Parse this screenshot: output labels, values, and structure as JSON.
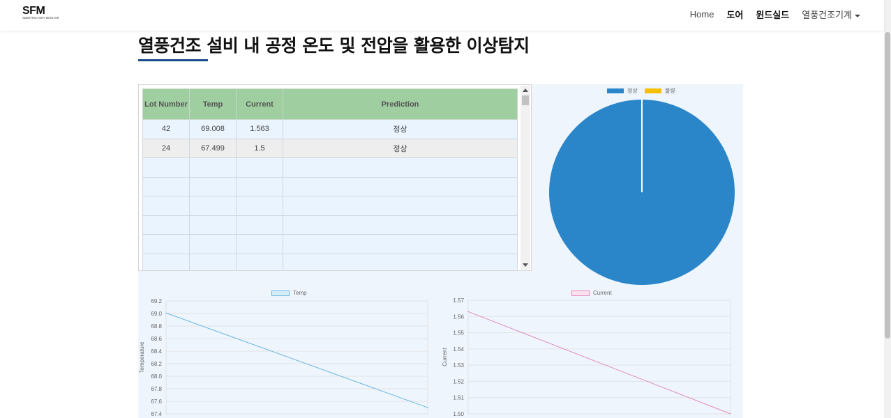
{
  "logo": {
    "main": "SFM",
    "sub": "SMARTFACTORY MONITOR"
  },
  "nav": {
    "home": "Home",
    "door": "도어",
    "windshield": "윈드실드",
    "dryer": "열풍건조기계"
  },
  "page": {
    "title": "열풍건조 설비 내 공정 온도 및 전압을 활용한 이상탐지"
  },
  "table": {
    "headers": {
      "lot": "Lot Number",
      "temp": "Temp",
      "current": "Current",
      "prediction": "Prediction"
    },
    "rows": [
      {
        "lot": "42",
        "temp": "69.008",
        "current": "1.563",
        "prediction": "정상"
      },
      {
        "lot": "24",
        "temp": "67.499",
        "current": "1.5",
        "prediction": "정상"
      }
    ],
    "empty_rows": 6
  },
  "colors": {
    "normal": "#2a86c8",
    "defect": "#f5c000",
    "temp_line": "#6cb8e0",
    "current_line": "#e48ac0",
    "header_green": "#9fcfa0",
    "panel_bg": "#eef5fd",
    "title_underline": "#1a4b8f"
  },
  "chart_data": [
    {
      "type": "pie",
      "legend": [
        "정상",
        "불량"
      ],
      "values": [
        2,
        0
      ],
      "legend_position": "top"
    },
    {
      "type": "line",
      "legend": [
        "Temp"
      ],
      "ylabel": "Temperature",
      "ylim": [
        67.4,
        69.2
      ],
      "yticks": [
        "69.2",
        "69.0",
        "68.8",
        "68.6",
        "68.4",
        "68.2",
        "68.0",
        "67.8",
        "67.6",
        "67.4"
      ],
      "series": [
        {
          "name": "Temp",
          "values": [
            69.008,
            67.499
          ]
        }
      ],
      "grid": true
    },
    {
      "type": "line",
      "legend": [
        "Current"
      ],
      "ylabel": "Current",
      "ylim": [
        1.5,
        1.57
      ],
      "yticks": [
        "1.57",
        "1.56",
        "1.55",
        "1.54",
        "1.53",
        "1.52",
        "1.51",
        "1.50"
      ],
      "series": [
        {
          "name": "Current",
          "values": [
            1.563,
            1.5
          ]
        }
      ],
      "grid": true
    }
  ]
}
